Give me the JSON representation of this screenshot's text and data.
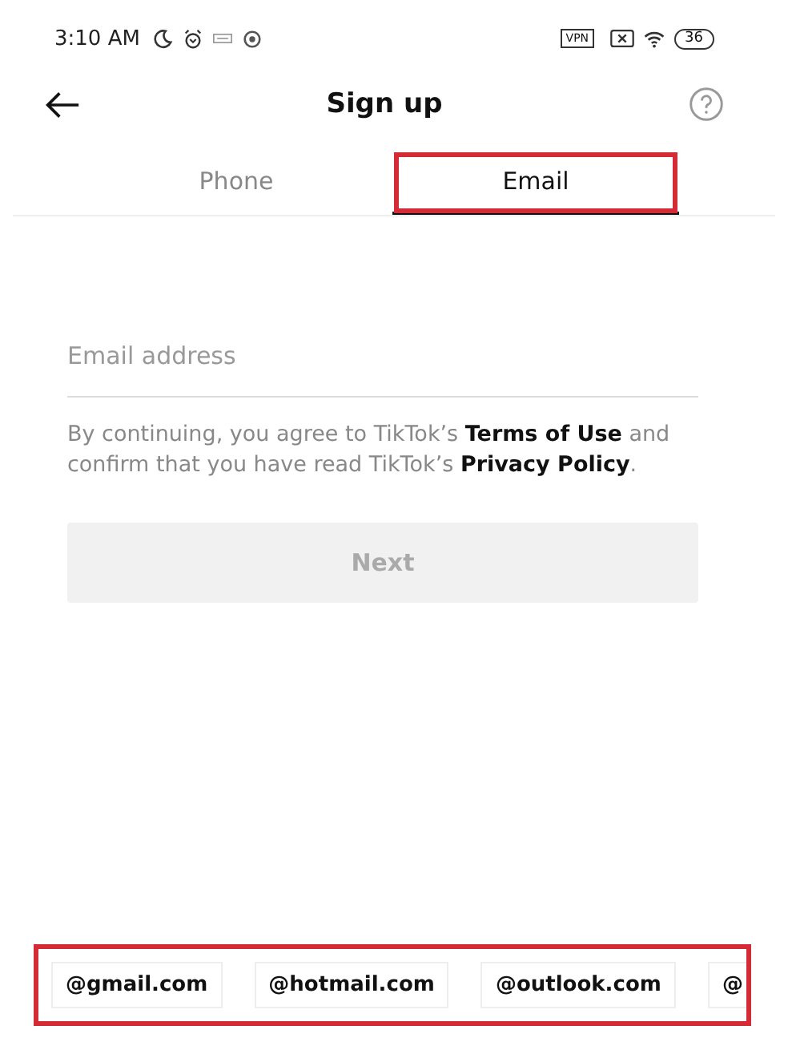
{
  "status_bar": {
    "time": "3:10 AM",
    "vpn": "VPN",
    "battery": "36"
  },
  "header": {
    "title": "Sign up"
  },
  "tabs": [
    {
      "label": "Phone",
      "selected": false,
      "highlighted": false
    },
    {
      "label": "Email",
      "selected": true,
      "highlighted": true
    }
  ],
  "email_field": {
    "placeholder": "Email address"
  },
  "legal": "By continuing, you agree to TikTok’s  **Terms of Use** and confirm that you have read TikTok’s  **Privacy Policy**.",
  "next_button": {
    "label": "Next",
    "disabled": true
  },
  "suggestions": {
    "highlighted": true,
    "items": [
      "@gmail.com",
      "@hotmail.com",
      "@outlook.com",
      "@"
    ]
  }
}
